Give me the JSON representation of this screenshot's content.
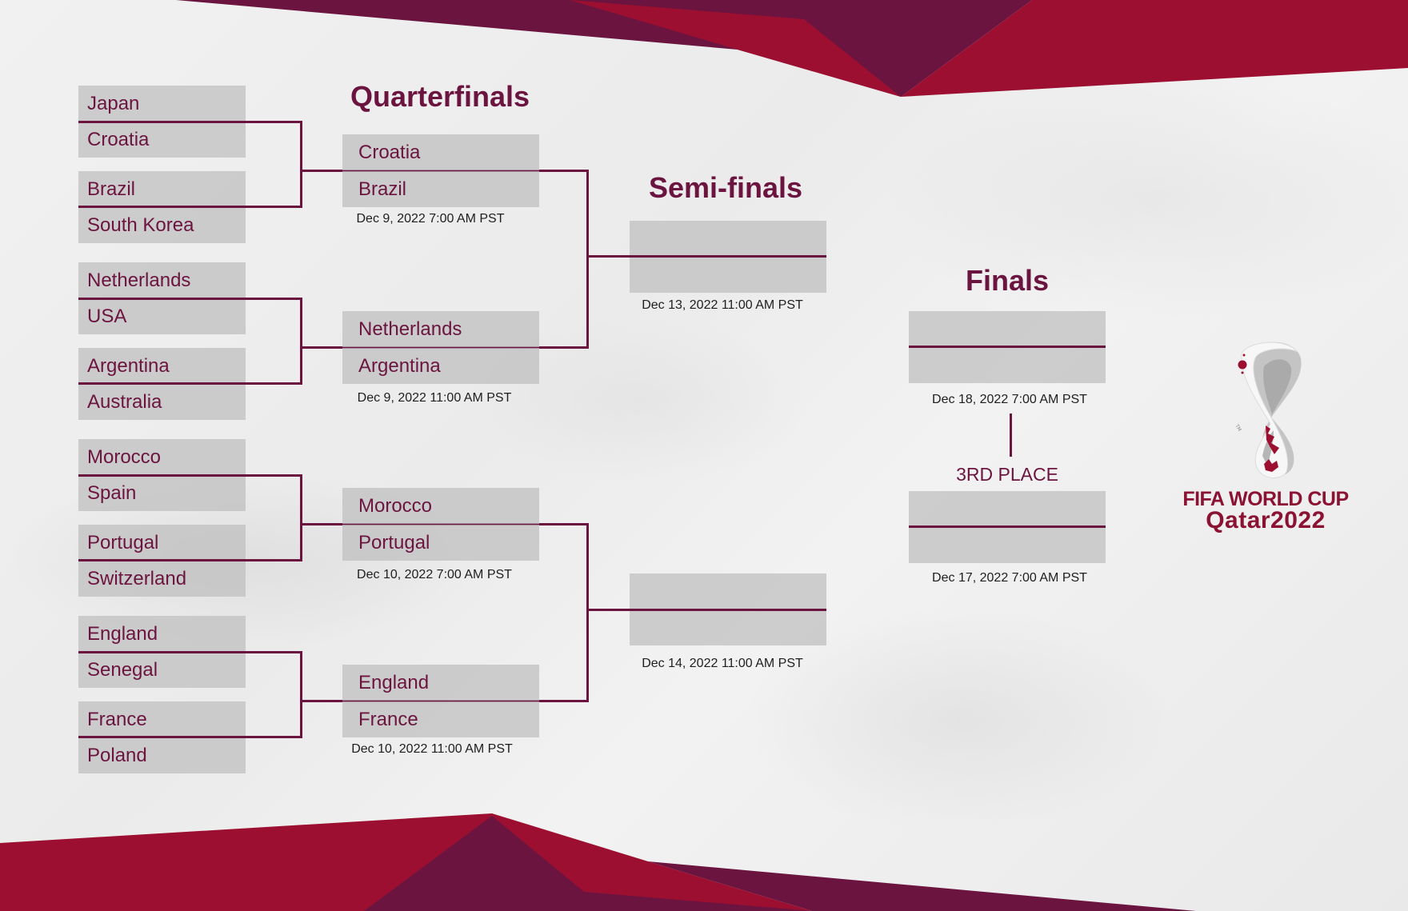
{
  "colors": {
    "primary": "#6B1440",
    "accent": "#9D0F30",
    "box_fill": "#C4C4C4",
    "date_text": "#1E1E1E"
  },
  "titles": {
    "quarterfinals": "Quarterfinals",
    "semifinals": "Semi-finals",
    "finals": "Finals",
    "third_place": "3RD PLACE"
  },
  "round_of_16": [
    {
      "team_a": "Japan",
      "team_b": "Croatia"
    },
    {
      "team_a": "Brazil",
      "team_b": "South Korea"
    },
    {
      "team_a": "Netherlands",
      "team_b": "USA"
    },
    {
      "team_a": "Argentina",
      "team_b": "Australia"
    },
    {
      "team_a": "Morocco",
      "team_b": "Spain"
    },
    {
      "team_a": "Portugal",
      "team_b": "Switzerland"
    },
    {
      "team_a": "England",
      "team_b": "Senegal"
    },
    {
      "team_a": "France",
      "team_b": "Poland"
    }
  ],
  "quarterfinals": [
    {
      "team_a": "Croatia",
      "team_b": "Brazil",
      "date": "Dec 9, 2022 7:00 AM PST"
    },
    {
      "team_a": "Netherlands",
      "team_b": "Argentina",
      "date": "Dec 9, 2022 11:00 AM PST"
    },
    {
      "team_a": "Morocco",
      "team_b": "Portugal",
      "date": "Dec 10, 2022 7:00 AM PST"
    },
    {
      "team_a": "England",
      "team_b": "France",
      "date": "Dec 10, 2022 11:00 AM PST"
    }
  ],
  "semifinals": [
    {
      "team_a": "",
      "team_b": "",
      "date": "Dec 13, 2022 11:00 AM PST"
    },
    {
      "team_a": "",
      "team_b": "",
      "date": "Dec 14, 2022 11:00 AM PST"
    }
  ],
  "final": {
    "team_a": "",
    "team_b": "",
    "date": "Dec 18, 2022 7:00 AM PST"
  },
  "third_place_match": {
    "team_a": "",
    "team_b": "",
    "date": "Dec 17, 2022 7:00 AM PST"
  },
  "logo": {
    "line1": "FIFA WORLD CUP",
    "line2": "Qatar2022",
    "emblem_icon": "world-cup-emblem-icon"
  }
}
